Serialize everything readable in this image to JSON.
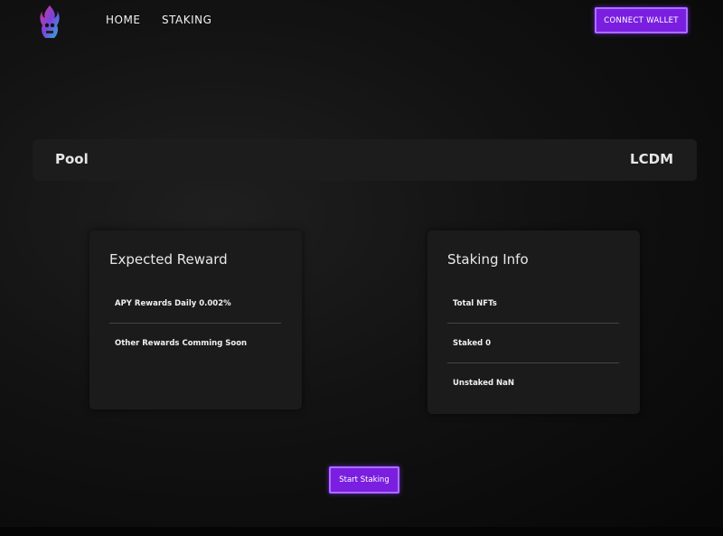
{
  "header": {
    "logo_icon": "flame-skull-logo-icon",
    "nav": [
      {
        "label": "HOME"
      },
      {
        "label": "STAKING"
      }
    ],
    "connect_wallet_label": "CONNECT WALLET"
  },
  "pool": {
    "label": "Pool",
    "token": "LCDM"
  },
  "expected_reward": {
    "title": "Expected Reward",
    "rows": [
      "APY Rewards Daily 0.002%",
      "Other Rewards Comming Soon"
    ]
  },
  "staking_info": {
    "title": "Staking Info",
    "rows": [
      "Total NFTs",
      "Staked 0",
      "Unstaked NaN"
    ]
  },
  "start_staking_label": "Start Staking",
  "colors": {
    "accent": "#7a1fe0",
    "accent_border": "#a970ff",
    "background": "#0a0a0a",
    "card": "#1b1b1b"
  }
}
